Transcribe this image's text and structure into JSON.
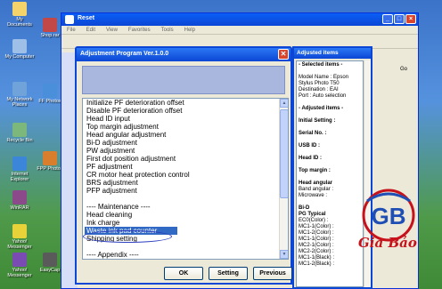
{
  "desktop": {
    "icons": [
      {
        "label": "My Documents",
        "color": "#f3d36a"
      },
      {
        "label": "My Computer",
        "color": "#9ec0e8"
      },
      {
        "label": "My Network Places",
        "color": "#6fa3d9"
      },
      {
        "label": "Recycle Bin",
        "color": "#7cb87c"
      },
      {
        "label": "Internet Explorer",
        "color": "#3b86d9"
      },
      {
        "label": "WinRAR",
        "color": "#8b4b8b"
      },
      {
        "label": "Yahoo! Messenger",
        "color": "#7a4bb3"
      },
      {
        "label": "Yahoo! Messenger",
        "color": "#e8d23a"
      },
      {
        "label": "Shop.rar",
        "color": "#c24848"
      },
      {
        "label": "FF Photos",
        "color": "#4a8fd9"
      },
      {
        "label": "FPP Photos",
        "color": "#d97e2c"
      },
      {
        "label": "EasyCap",
        "color": "#5a5a5a"
      }
    ]
  },
  "background_window": {
    "title": "Reset",
    "menu": [
      "File",
      "Edit",
      "View",
      "Favorites",
      "Tools",
      "Help"
    ],
    "go_label": "Go"
  },
  "dialog": {
    "title": "Adjustment Program Ver.1.0.0",
    "close_symbol": "✕",
    "list_items": [
      "Initialize PF deterioration offset",
      "Disable PF deterioration offset",
      "Head ID input",
      "Top margin adjustment",
      "Head angular adjustment",
      "Bi-D adjustment",
      "PW adjustment",
      "First dot position adjustment",
      "PF adjustment",
      "CR motor heat protection control",
      "BRS adjustment",
      "PFP adjustment",
      "",
      "---- Maintenance ----",
      "Head cleaning",
      "Ink charge",
      "Waste ink pad counter",
      "Shipping setting",
      "",
      "---- Appendix ----"
    ],
    "selected_index": 16,
    "buttons": {
      "ok": "OK",
      "setting": "Setting",
      "previous": "Previous"
    }
  },
  "adjusted_panel": {
    "title": "Adjusted items",
    "lines": [
      "- Selected items -",
      "",
      "Model Name : Epson",
      "Stylus Photo T50",
      "Destination : EAI",
      "Port : Auto selection",
      "",
      "- Adjusted items -",
      "",
      "Initial Setting :",
      "",
      "Serial No. :",
      "",
      "USB ID :",
      "",
      "Head ID :",
      "",
      "Top margin :",
      "",
      "Head angular",
      " Band angular :",
      " Microwave :",
      "",
      "Bi-D",
      "PG Typical",
      " EC0(Color) :",
      " MC1-1(Color) :",
      " MC1-2(Color) :",
      " MC1-1(Color) :",
      " MC2-1(Color) :",
      " MC2-2(Color) :",
      " MC1-1(Black) :",
      " MC1-2(Black) :"
    ]
  },
  "logo": {
    "mark": "GB",
    "text": "Gia Bảo",
    "color": "#c7121b"
  }
}
